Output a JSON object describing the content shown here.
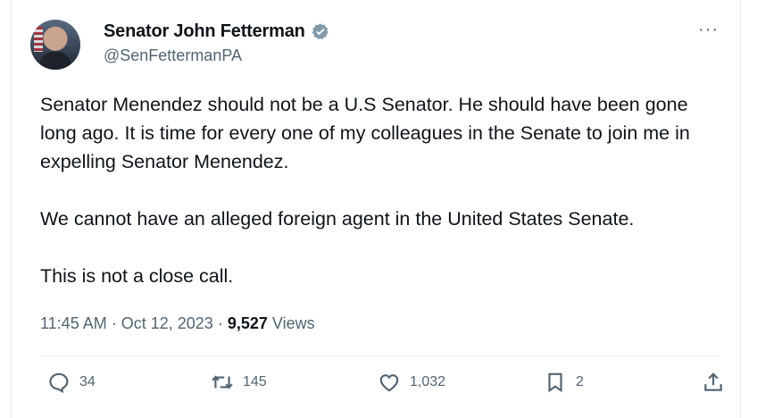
{
  "tweet": {
    "display_name": "Senator John Fetterman",
    "handle": "@SenFettermanPA",
    "paragraphs": [
      "Senator Menendez should not be a U.S Senator. He should have been gone long ago. It is time for every one of my colleagues in the Senate to join me in expelling Senator Menendez.",
      "We cannot have an alleged foreign agent in the United States Senate.",
      "This is not a close call."
    ],
    "time": "11:45 AM",
    "date": "Oct 12, 2023",
    "views_count": "9,527",
    "views_label": "Views",
    "separator": "·",
    "more_label": "···"
  },
  "stats": {
    "replies": "34",
    "retweets": "145",
    "likes": "1,032",
    "bookmarks": "2"
  },
  "icons": {
    "verified": "verified-badge-icon",
    "more": "more-icon",
    "reply": "reply-icon",
    "retweet": "retweet-icon",
    "like": "heart-icon",
    "bookmark": "bookmark-icon",
    "share": "share-icon"
  },
  "colors": {
    "text": "#0f1419",
    "secondary": "#536471",
    "badge": "#829aab",
    "divider": "#e6ecf0"
  }
}
